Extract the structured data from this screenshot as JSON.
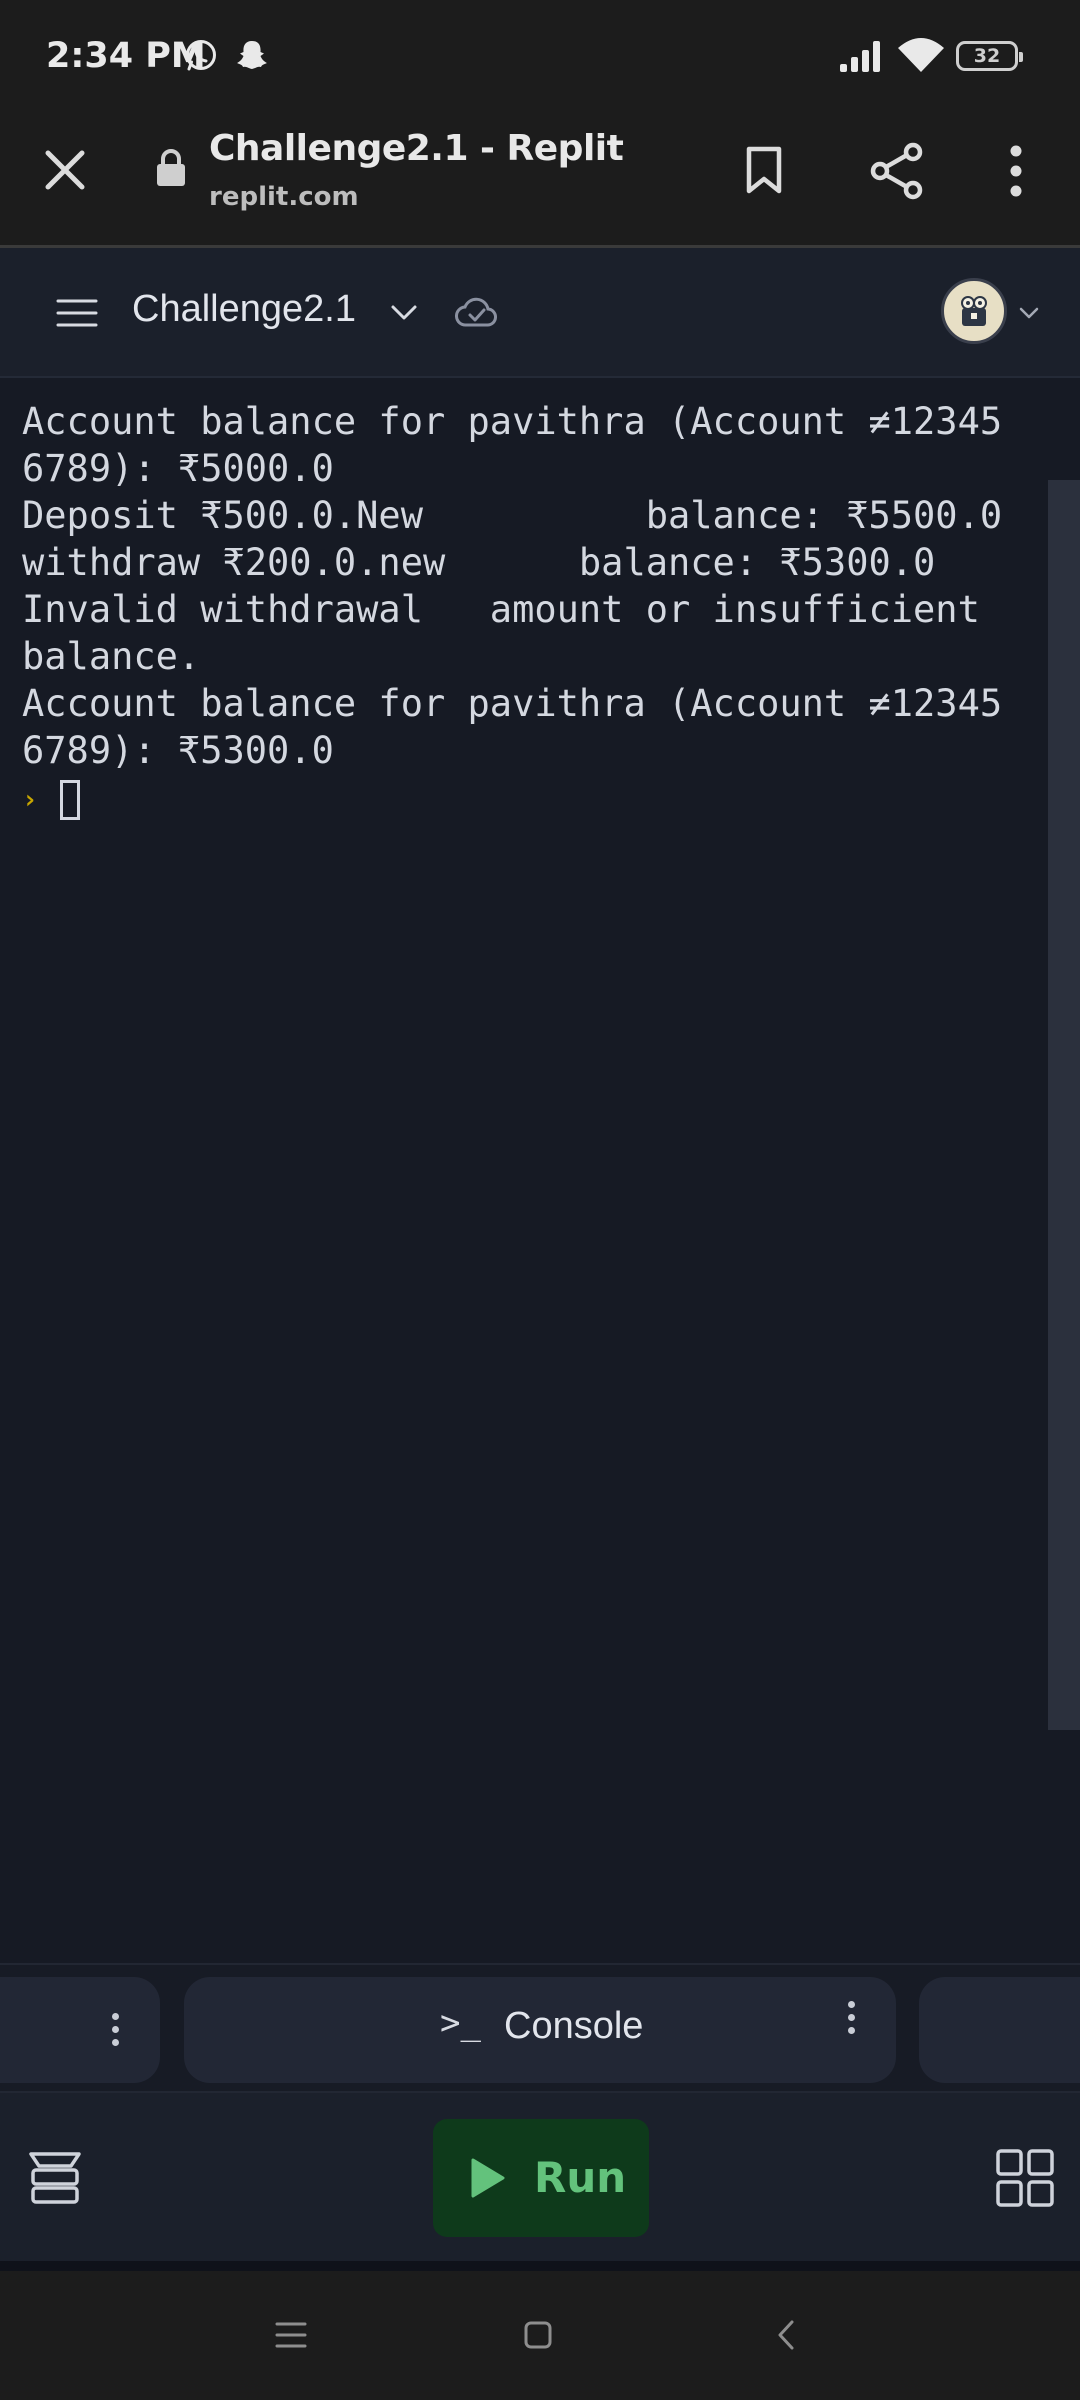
{
  "status_bar": {
    "time": "2:34 PM",
    "battery_level": "32",
    "icons": [
      "whatsapp-icon",
      "snapchat-icon",
      "signal-icon",
      "wifi-icon",
      "battery-icon"
    ]
  },
  "browser": {
    "page_title": "Challenge2.1 - Replit",
    "url": "replit.com",
    "icons": [
      "close-icon",
      "lock-icon",
      "bookmark-icon",
      "share-icon",
      "more-vertical-icon"
    ]
  },
  "replit_header": {
    "repl_name": "Challenge2.1",
    "icons": [
      "hamburger-menu-icon",
      "chevron-down-icon",
      "cloud-sync-icon",
      "avatar",
      "chevron-down-icon"
    ]
  },
  "console": {
    "lines": [
      "Account balance for pavithra (Account ≠12345",
      "6789): ₹5000.0",
      "Deposit ₹500.0.New          balance: ₹5500.0",
      "withdraw ₹200.0.new      balance: ₹5300.0",
      "Invalid withdrawal   amount or insufficient",
      "balance.",
      "Account balance for pavithra (Account ≠12345",
      "6789): ₹5300.0"
    ],
    "prompt_symbol": "›"
  },
  "tabs": {
    "active_tab_label": "Console",
    "active_tab_icon": ">_"
  },
  "actions": {
    "run_label": "Run",
    "colors": {
      "run_bg": "#0e3a1b",
      "run_fg": "#63c27c",
      "prompt": "#c7a600"
    }
  },
  "nav": {
    "icons": [
      "recents-icon",
      "home-icon",
      "back-icon"
    ]
  }
}
